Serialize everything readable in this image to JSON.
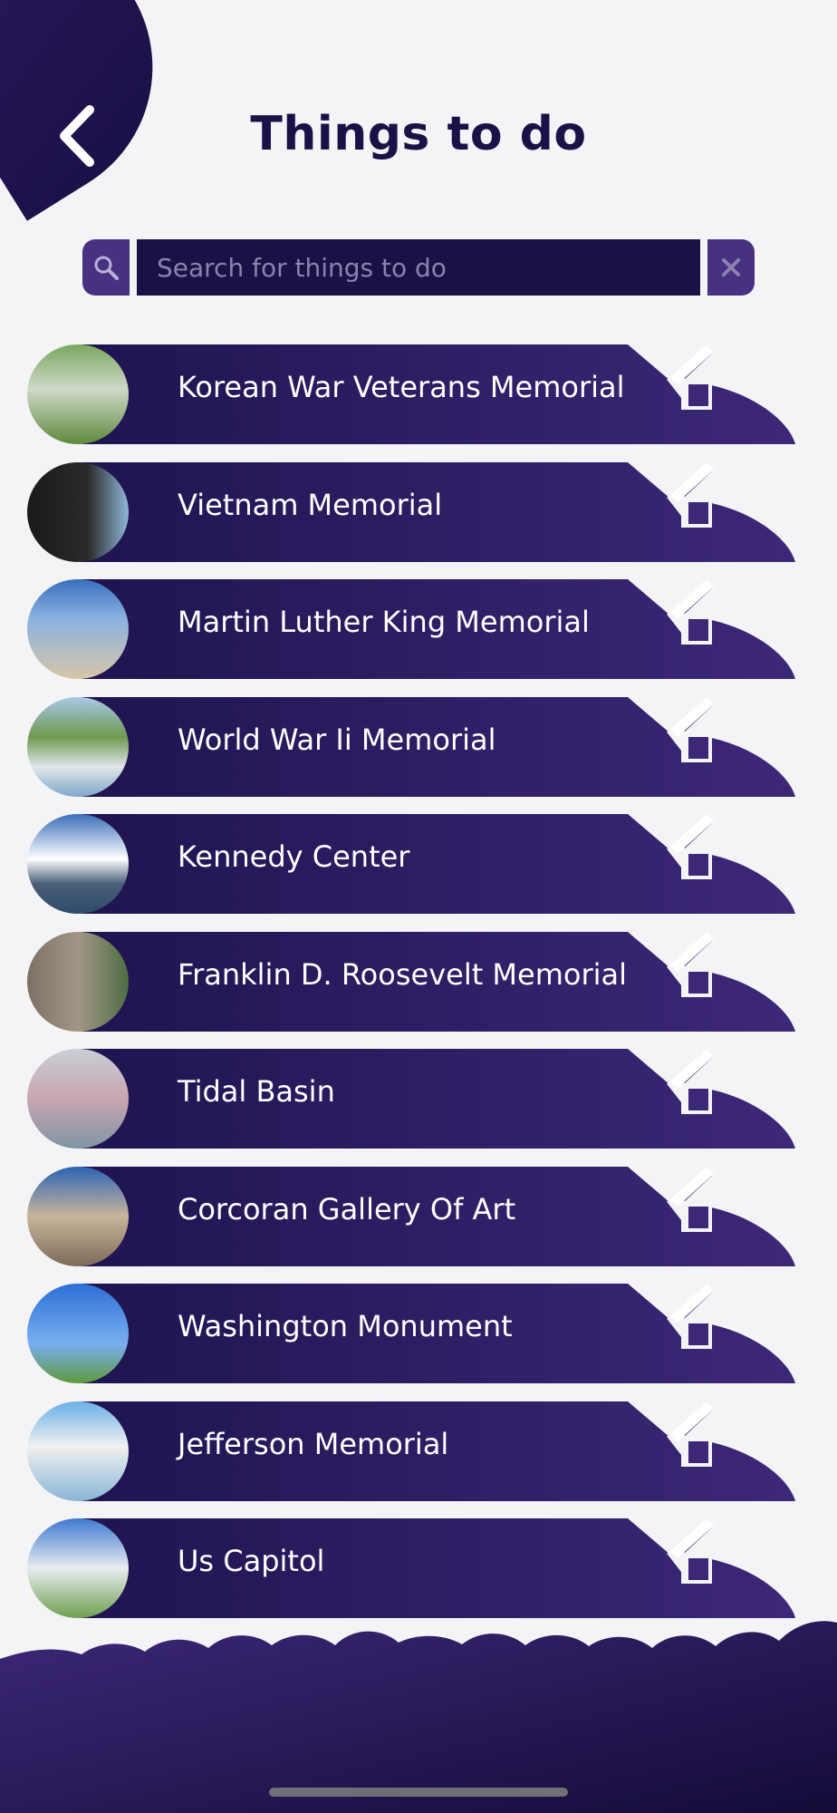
{
  "header": {
    "title": "Things to do",
    "back_icon": "chevron-left-icon"
  },
  "search": {
    "placeholder": "Search for things to do",
    "value": "",
    "search_icon": "search-icon",
    "clear_icon": "close-icon"
  },
  "colors": {
    "primary_dark": "#1c1147",
    "primary": "#2a1a5e",
    "accent": "#473181",
    "background": "#f4f4f6"
  },
  "items": [
    {
      "label": "Korean War Veterans Memorial",
      "thumb": "memorial statues in grass"
    },
    {
      "label": "Vietnam Memorial",
      "thumb": "black granite wall"
    },
    {
      "label": "Martin Luther King Memorial",
      "thumb": "stone sculpture"
    },
    {
      "label": "World War Ii Memorial",
      "thumb": "fountain plaza"
    },
    {
      "label": "Kennedy Center",
      "thumb": "white building by water"
    },
    {
      "label": "Franklin D. Roosevelt Memorial",
      "thumb": "bronze statue"
    },
    {
      "label": "Tidal Basin",
      "thumb": "cherry blossoms and water"
    },
    {
      "label": "Corcoran Gallery Of Art",
      "thumb": "classical building"
    },
    {
      "label": "Washington Monument",
      "thumb": "obelisk"
    },
    {
      "label": "Jefferson Memorial",
      "thumb": "domed memorial"
    },
    {
      "label": "Us Capitol",
      "thumb": "capitol dome"
    }
  ]
}
